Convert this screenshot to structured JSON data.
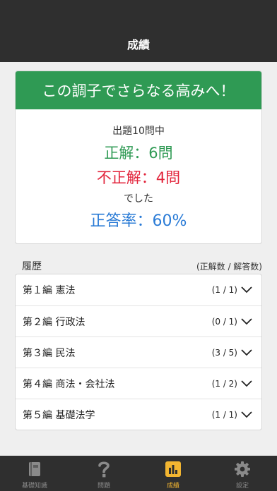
{
  "header": {
    "title": "成績"
  },
  "result": {
    "banner": "この調子でさらなる高みへ！",
    "total_line": "出題10問中",
    "correct_line": "正解：6問",
    "wrong_line": "不正解：4問",
    "deshita": "でした",
    "rate_line": "正答率：60%"
  },
  "history": {
    "title": "履歴",
    "subtitle": "(正解数 / 解答数)",
    "rows": [
      {
        "label": "第１編 憲法",
        "count": "(1 / 1)"
      },
      {
        "label": "第２編 行政法",
        "count": "(0 / 1)"
      },
      {
        "label": "第３編 民法",
        "count": "(3 / 5)"
      },
      {
        "label": "第４編 商法・会社法",
        "count": "(1 / 2)"
      },
      {
        "label": "第５編 基礎法学",
        "count": "(1 / 1)"
      }
    ]
  },
  "tabs": [
    {
      "label": "基礎知識",
      "icon": "book-icon",
      "active": false
    },
    {
      "label": "問題",
      "icon": "question-icon",
      "active": false
    },
    {
      "label": "成績",
      "icon": "bar-chart-icon",
      "active": true
    },
    {
      "label": "設定",
      "icon": "gear-icon",
      "active": false
    }
  ],
  "colors": {
    "banner": "#2f9a54",
    "correct": "#2f9a54",
    "wrong": "#e2233a",
    "rate": "#2a7bd6",
    "active_tab": "#f2b531",
    "bar": "#2f2f2f"
  }
}
